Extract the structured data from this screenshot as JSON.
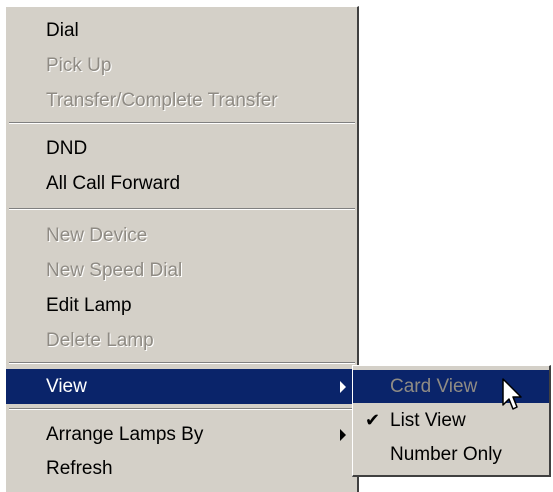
{
  "context_menu": {
    "items": [
      {
        "label": "Dial",
        "enabled": true
      },
      {
        "label": "Pick Up",
        "enabled": false
      },
      {
        "label": "Transfer/Complete Transfer",
        "enabled": false
      },
      {
        "label": "DND",
        "enabled": true
      },
      {
        "label": "All Call Forward",
        "enabled": true
      },
      {
        "label": "New Device",
        "enabled": false
      },
      {
        "label": "New Speed Dial",
        "enabled": false
      },
      {
        "label": "Edit Lamp",
        "enabled": true
      },
      {
        "label": "Delete Lamp",
        "enabled": false
      },
      {
        "label": "View",
        "enabled": true,
        "selected": true,
        "has_submenu": true
      },
      {
        "label": "Arrange Lamps By",
        "enabled": true,
        "has_submenu": true
      },
      {
        "label": "Refresh",
        "enabled": true
      }
    ]
  },
  "view_submenu": {
    "items": [
      {
        "label": "Card View",
        "enabled": false,
        "selected": true
      },
      {
        "label": "List View",
        "enabled": true,
        "checked": true,
        "check_glyph": "✔"
      },
      {
        "label": "Number Only",
        "enabled": true
      }
    ]
  },
  "colors": {
    "menu_bg": "#d4d0c8",
    "highlight": "#0a246a",
    "disabled_text": "#8f8b84"
  }
}
